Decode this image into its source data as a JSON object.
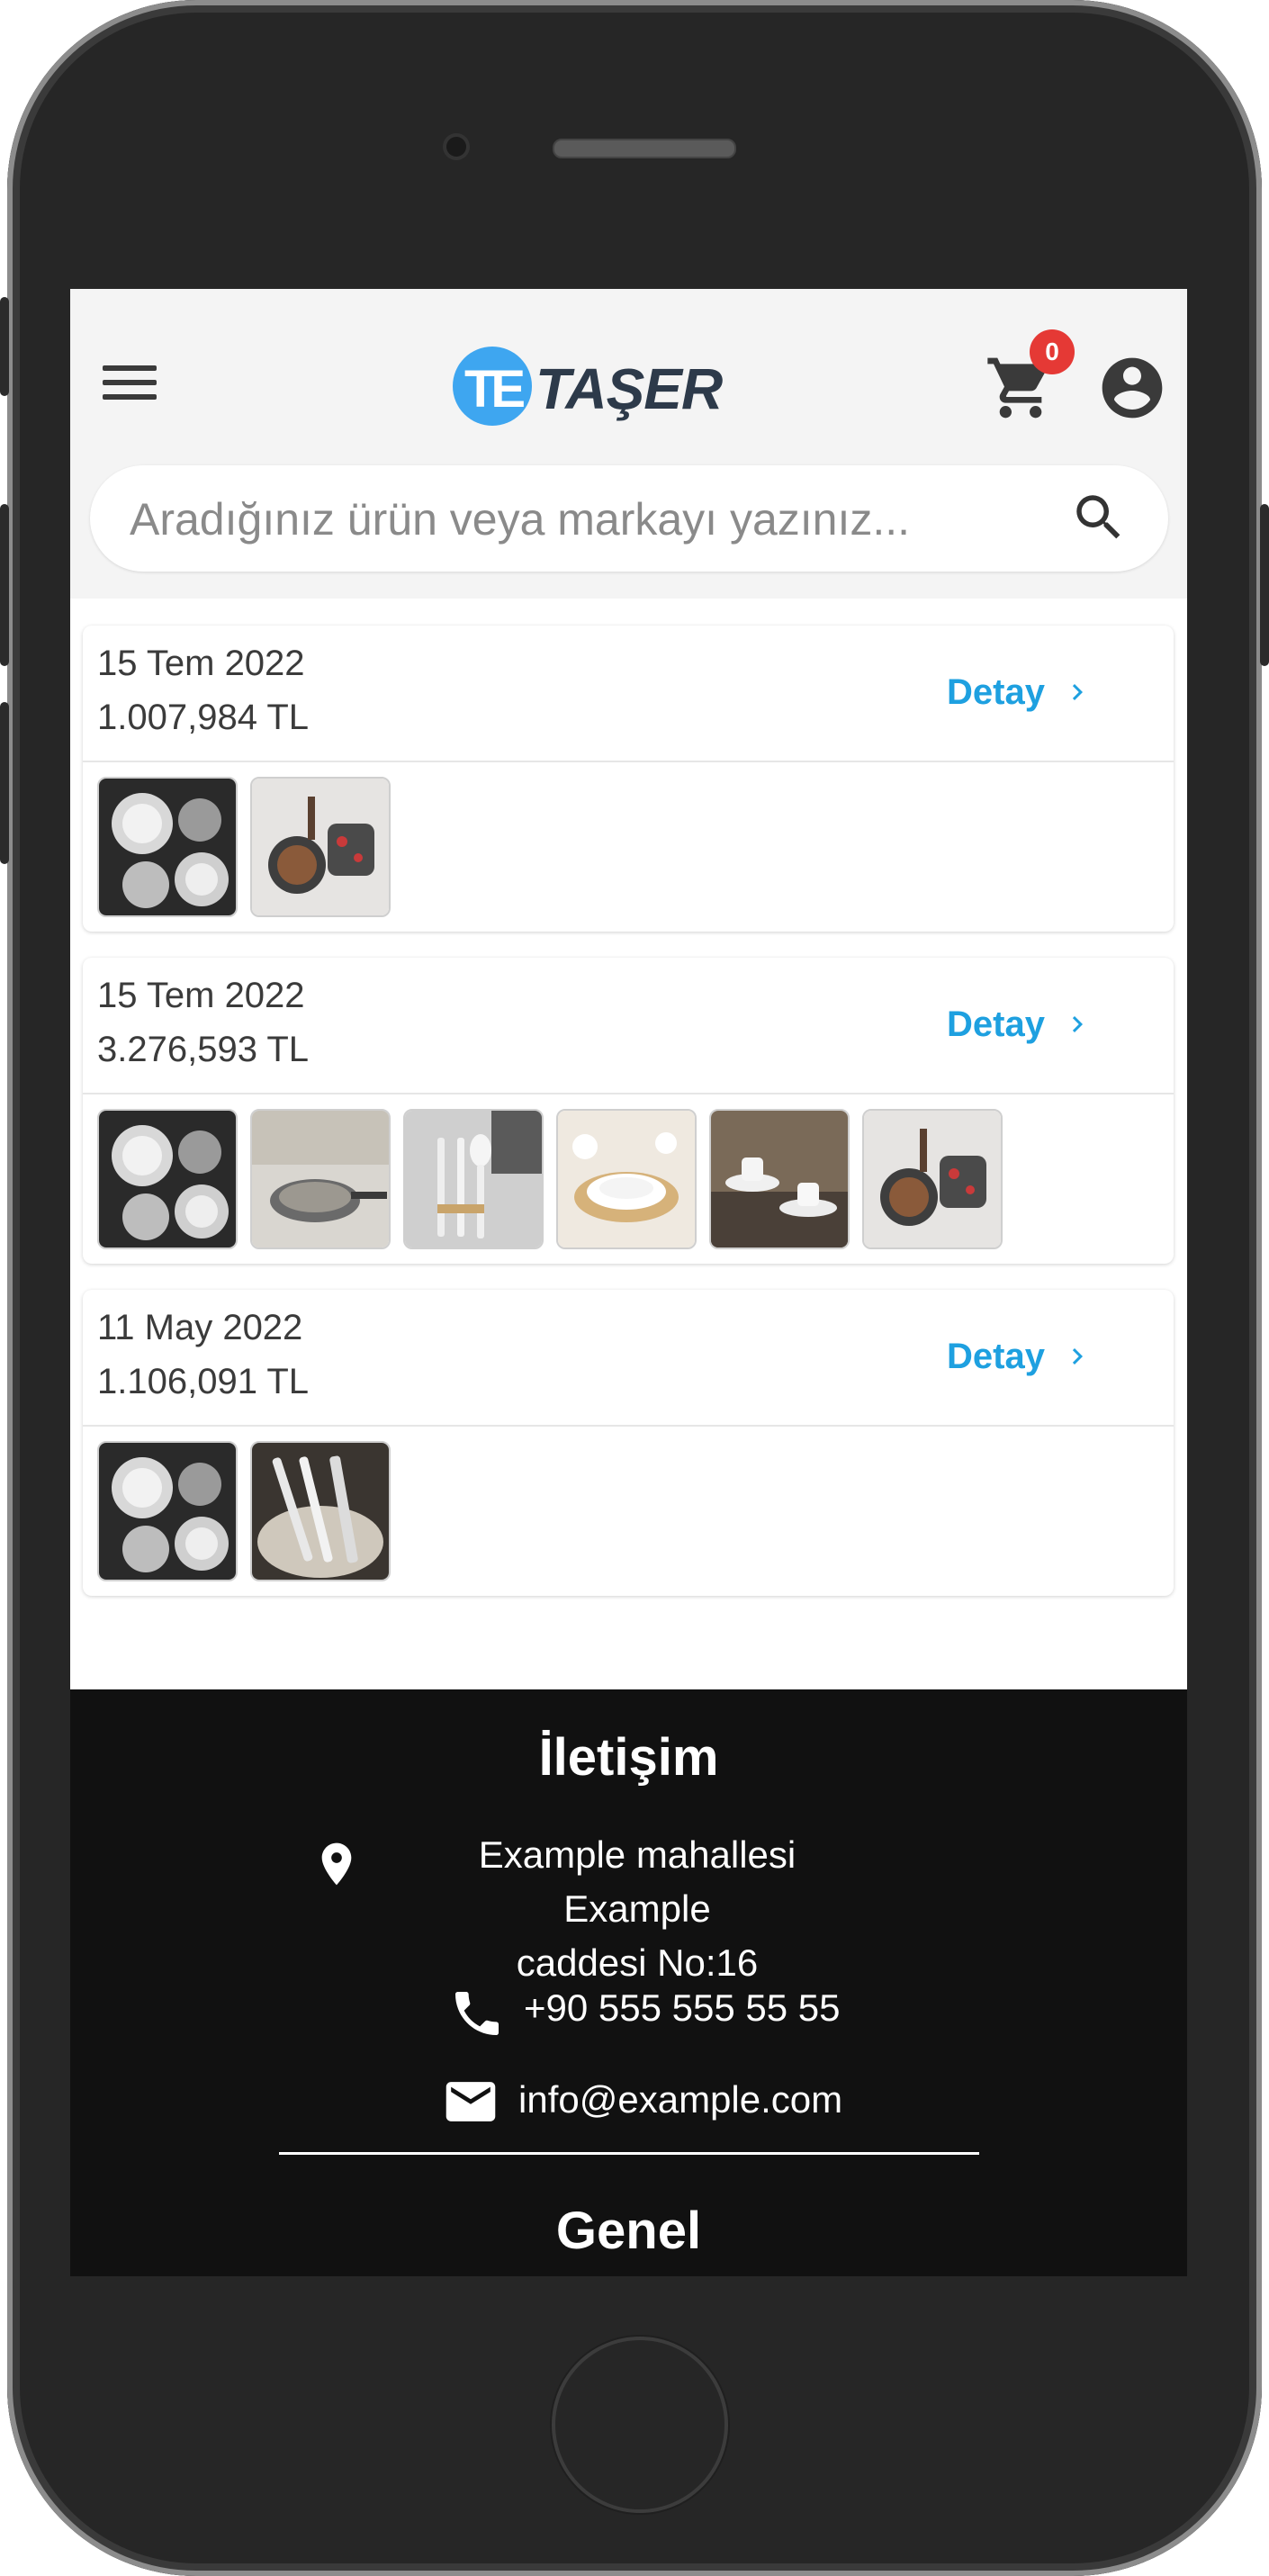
{
  "header": {
    "logo_text": "TAŞER",
    "cart_count": "0",
    "search_placeholder": "Aradığınız ürün veya markayı yazınız..."
  },
  "orders": [
    {
      "date": "15 Tem 2022",
      "total": "1.007,984 TL",
      "detail_label": "Detay",
      "thumbs": 2
    },
    {
      "date": "15 Tem 2022",
      "total": "3.276,593 TL",
      "detail_label": "Detay",
      "thumbs": 6
    },
    {
      "date": "11 May 2022",
      "total": "1.106,091 TL",
      "detail_label": "Detay",
      "thumbs": 2
    }
  ],
  "footer": {
    "contact_title": "İletişim",
    "address_line1": "Example mahallesi Example",
    "address_line2": "caddesi No:16",
    "phone": "+90 555 555 55 55",
    "email": "info@example.com",
    "general_title": "Genel"
  },
  "colors": {
    "accent": "#1ea0e0",
    "badge": "#e53935",
    "footer_bg": "#111111"
  }
}
